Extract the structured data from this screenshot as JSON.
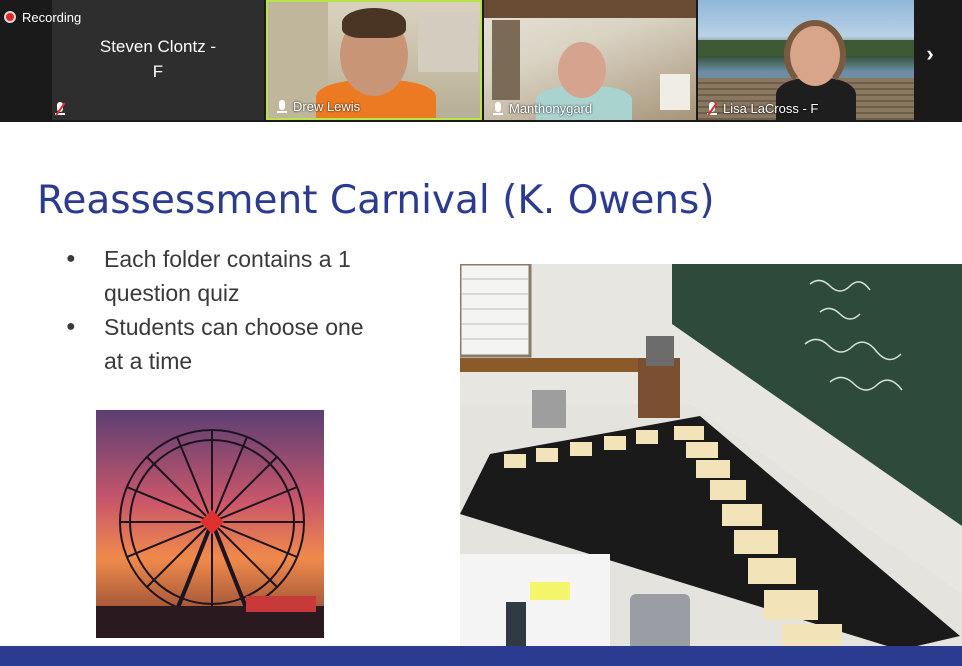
{
  "recording": {
    "label": "Recording"
  },
  "participants": [
    {
      "name": "Steven Clontz - F",
      "big_name_line1": "Steven Clontz -",
      "big_name_line2": "F",
      "muted": true
    },
    {
      "name": "Drew Lewis",
      "muted": false,
      "active_speaker": true
    },
    {
      "name": "Manthonygard",
      "muted": false
    },
    {
      "name": "Lisa LaCross - F",
      "muted": true
    }
  ],
  "colors": {
    "title": "#2b3b8f",
    "footer_bar": "#2b3b8f",
    "active_speaker_border": "#b9e34a",
    "recording_dot": "#e02828"
  },
  "icons": {
    "next_page": "chevron-right-icon",
    "mic": "microphone-icon",
    "mic_muted": "microphone-muted-icon"
  },
  "slide": {
    "title": "Reassessment Carnival (K. Owens)",
    "bullets": [
      {
        "marker": "●",
        "text": "Each folder contains a 1 question quiz"
      },
      {
        "marker": "●",
        "text": "Students can choose one at a time"
      }
    ]
  }
}
